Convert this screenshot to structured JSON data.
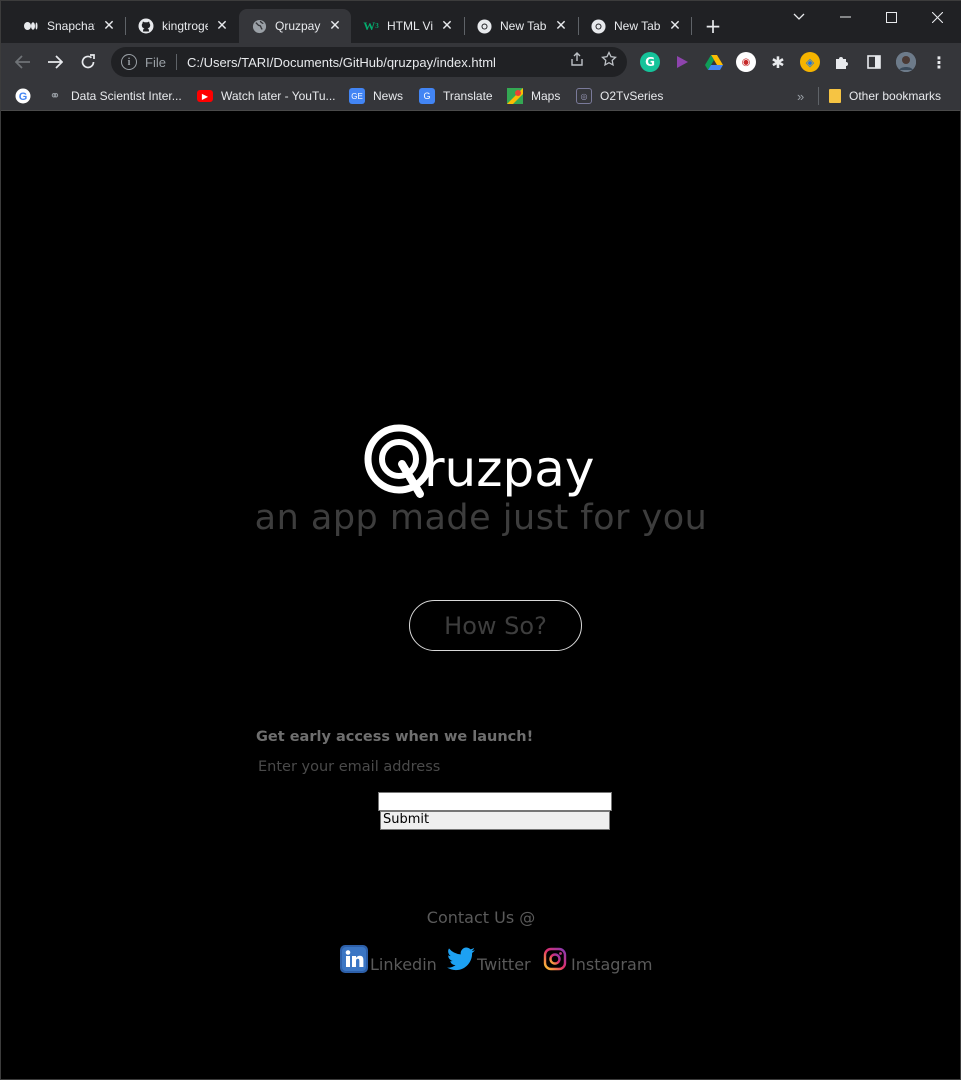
{
  "tabs": [
    {
      "title": "Snapchat",
      "icon": "medium-icon",
      "active": false
    },
    {
      "title": "kingtroge",
      "icon": "github-icon",
      "active": false
    },
    {
      "title": "Qruzpay",
      "icon": "globe-icon",
      "active": true
    },
    {
      "title": "HTML Vie",
      "icon": "w3-icon",
      "active": false
    },
    {
      "title": "New Tab",
      "icon": "chrome-icon",
      "active": false
    },
    {
      "title": "New Tab",
      "icon": "chrome-icon",
      "active": false
    }
  ],
  "toolbar": {
    "scheme": "File",
    "url": "C:/Users/TARI/Documents/GitHub/qruzpay/index.html"
  },
  "bookmarks": [
    {
      "label": "Data Scientist Inter...",
      "icon": "bookmark-ds-icon"
    },
    {
      "label": "Watch later - YouTu...",
      "icon": "youtube-icon"
    },
    {
      "label": "News",
      "icon": "google-news-icon"
    },
    {
      "label": "Translate",
      "icon": "google-translate-icon"
    },
    {
      "label": "Maps",
      "icon": "google-maps-icon"
    },
    {
      "label": "O2TvSeries",
      "icon": "o2tv-icon"
    }
  ],
  "other_bookmarks": "Other bookmarks",
  "hero": {
    "brand": "ruzpay",
    "brand_initial": "Q",
    "tagline": "an app made just for you",
    "cta": "How So?"
  },
  "signup": {
    "heading": "Get early access when we launch!",
    "label": "Enter your email address",
    "email_value": "",
    "submit": "Submit"
  },
  "contact": {
    "heading": "Contact Us @",
    "links": [
      {
        "label": "Linkedin",
        "icon": "linkedin-icon"
      },
      {
        "label": "Twitter",
        "icon": "twitter-icon"
      },
      {
        "label": "Instagram",
        "icon": "instagram-icon"
      }
    ]
  },
  "colors": {
    "page_bg": "#000000",
    "tagline": "#3d3d3d",
    "chrome_bg": "#202124",
    "toolbar_bg": "#35363a"
  }
}
